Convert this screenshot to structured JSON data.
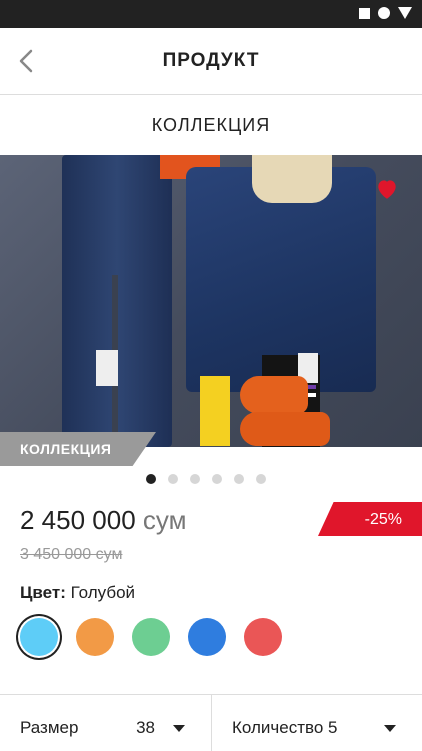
{
  "header": {
    "title": "ПРОДУКТ"
  },
  "subheader": {
    "title": "КОЛЛЕКЦИЯ"
  },
  "hero": {
    "label": "КОЛЛЕКЦИЯ",
    "dots_total": 6,
    "active_dot": 0,
    "favorite": true
  },
  "price": {
    "current": "2 450 000",
    "currency": "сум",
    "old": "3 450 000 сум",
    "discount": "-25%"
  },
  "color": {
    "label": "Цвет:",
    "value": "Голубой",
    "swatches": [
      "#5ecdf7",
      "#f29a46",
      "#6dce92",
      "#2f7ddf",
      "#ea5656"
    ],
    "selected_index": 0
  },
  "footer": {
    "size_label": "Размер",
    "size_value": "38",
    "qty_label": "Количество",
    "qty_value": "5"
  }
}
